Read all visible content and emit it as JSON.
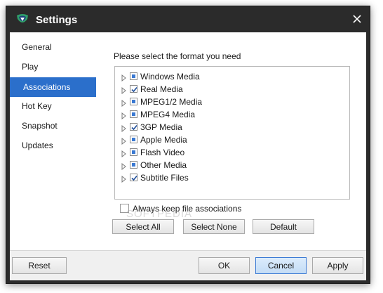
{
  "window": {
    "title": "Settings",
    "close_icon": "close-icon",
    "logo_icon": "app-logo-icon"
  },
  "sidebar": {
    "items": [
      {
        "label": "General",
        "active": false
      },
      {
        "label": "Play",
        "active": false
      },
      {
        "label": "Associations",
        "active": true
      },
      {
        "label": "Hot Key",
        "active": false
      },
      {
        "label": "Snapshot",
        "active": false
      },
      {
        "label": "Updates",
        "active": false
      }
    ]
  },
  "content": {
    "prompt": "Please select the format you need",
    "formats": [
      {
        "label": "Windows Media",
        "state": "partial"
      },
      {
        "label": "Real Media",
        "state": "checked"
      },
      {
        "label": "MPEG1/2 Media",
        "state": "partial"
      },
      {
        "label": "MPEG4 Media",
        "state": "partial"
      },
      {
        "label": "3GP Media",
        "state": "checked"
      },
      {
        "label": "Apple Media",
        "state": "partial"
      },
      {
        "label": "Flash Video",
        "state": "partial"
      },
      {
        "label": "Other Media",
        "state": "partial"
      },
      {
        "label": "Subtitle Files",
        "state": "checked"
      }
    ],
    "always_keep_label": "Always keep file associations",
    "always_keep_checked": false,
    "buttons": {
      "select_all": "Select All",
      "select_none": "Select None",
      "default": "Default"
    },
    "watermark": "SOFTPEDIA"
  },
  "footer": {
    "reset": "Reset",
    "ok": "OK",
    "cancel": "Cancel",
    "apply": "Apply"
  },
  "colors": {
    "titlebar": "#2b2b2b",
    "accent": "#2b6fcb",
    "checkbox_fill": "#3a79d2"
  }
}
